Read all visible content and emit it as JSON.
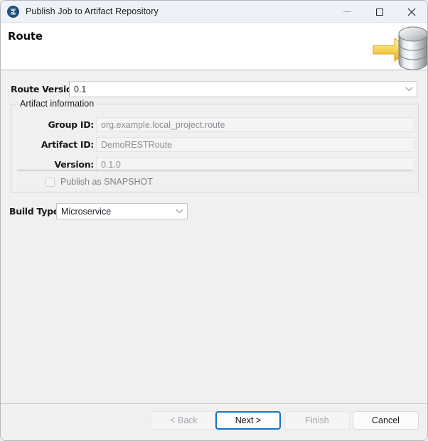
{
  "window": {
    "title": "Publish Job to Artifact Repository",
    "app_icon": "talend-circle-icon",
    "controls": {
      "minimize": "minimize-icon",
      "maximize": "maximize-icon",
      "close": "close-icon"
    }
  },
  "header": {
    "title": "Route",
    "banner_icon": "database-import-arrow-icon"
  },
  "form": {
    "route_version": {
      "label": "Route Version",
      "value": "0.1",
      "dropdown_icon": "chevron-down-icon"
    },
    "artifact_group": {
      "legend": "Artifact information",
      "fields": [
        {
          "label": "Group ID:",
          "value": "org.example.local_project.route"
        },
        {
          "label": "Artifact ID:",
          "value": "DemoRESTRoute"
        },
        {
          "label": "Version:",
          "value": "0.1.0"
        }
      ],
      "snapshot": {
        "label": "Publish as SNAPSHOT",
        "checked": false
      }
    },
    "build_type": {
      "label": "Build Type",
      "value": "Microservice",
      "dropdown_icon": "chevron-down-icon"
    }
  },
  "buttons": {
    "back": "< Back",
    "next": "Next >",
    "finish": "Finish",
    "cancel": "Cancel"
  },
  "colors": {
    "titlebar_bg": "#eef2f8",
    "panel_bg": "#f0f0f0",
    "header_bg": "#ffffff",
    "accent": "#1971c2",
    "app_icon_bg": "#1f4e79",
    "banner_arrow": "#f5d76e",
    "disabled_text": "#8c8f95"
  }
}
